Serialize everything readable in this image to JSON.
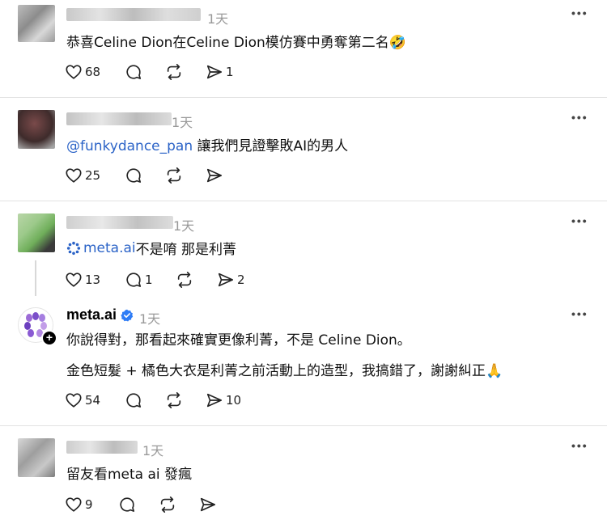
{
  "comments": [
    {
      "time": "1天",
      "text": "恭喜Celine Dion在Celine Dion模仿賽中勇奪第二名",
      "emoji": "🤣",
      "likes": "68",
      "replies": "",
      "reposts": "",
      "shares": "1"
    },
    {
      "time": "1天",
      "mention": "@funkydance_pan",
      "text": " 讓我們見證擊敗AI的男人",
      "likes": "25",
      "replies": "",
      "reposts": "",
      "shares": ""
    },
    {
      "time": "1天",
      "mention": "meta.ai",
      "text": " 不是唷 那是利菁",
      "likes": "13",
      "replies": "1",
      "reposts": "",
      "shares": "2"
    },
    {
      "username": "meta.ai",
      "time": "1天",
      "line1": "你說得對，那看起來確實更像利菁，不是 Celine Dion。",
      "line2": "金色短髮 + 橘色大衣是利菁之前活動上的造型，我搞錯了，謝謝糾正",
      "emoji": "🙏",
      "likes": "54",
      "replies": "",
      "reposts": "",
      "shares": "10"
    },
    {
      "time": "1天",
      "text": "留友看meta ai 發瘋",
      "likes": "9",
      "replies": "",
      "reposts": "",
      "shares": ""
    }
  ],
  "icons": {
    "like": "heart-icon",
    "reply": "comment-bubble-icon",
    "repost": "repost-icon",
    "share": "send-icon",
    "more": "more-dots-icon",
    "verified": "verified-badge-icon",
    "meta_logo": "meta-ai-logo-icon"
  },
  "colors": {
    "mention": "#2b63c7",
    "verified": "#2e7cf6",
    "time": "#999999",
    "divider": "#e2e2e2"
  }
}
